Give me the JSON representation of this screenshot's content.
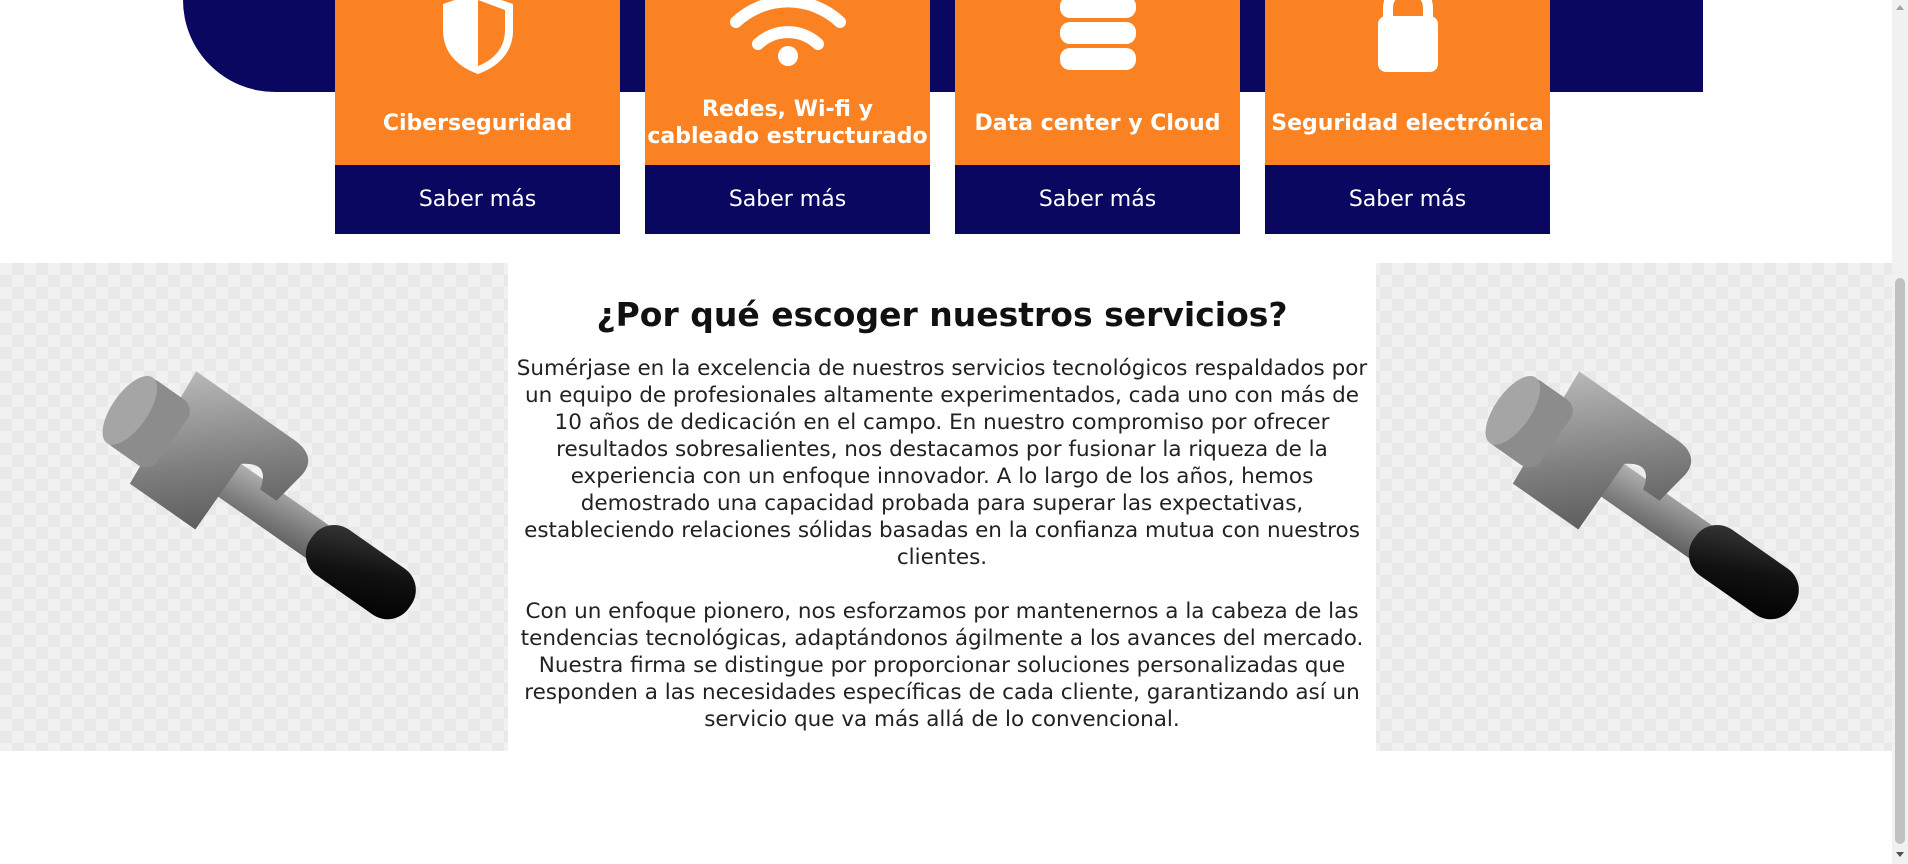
{
  "colors": {
    "brand_orange": "#fa8223",
    "brand_navy": "#0a0760",
    "text_dark": "#111111"
  },
  "services": [
    {
      "title": "Ciberseguridad",
      "icon": "shield-icon",
      "button": "Saber más"
    },
    {
      "title": "Redes, Wi-fi y cableado estructurado",
      "icon": "wifi-icon",
      "button": "Saber más"
    },
    {
      "title": "Data center y Cloud",
      "icon": "database-icon",
      "button": "Saber más"
    },
    {
      "title": "Seguridad electrónica",
      "icon": "lock-icon",
      "button": "Saber más"
    }
  ],
  "why": {
    "title": "¿Por qué escoger nuestros servicios?",
    "paragraph1_lines": [
      "Sumérjase en la excelencia de nuestros servicios tecnológicos respaldados por",
      "un equipo de profesionales altamente experimentados, cada uno con más de",
      "10 años de dedicación en el campo. En nuestro compromiso por ofrecer",
      "resultados sobresalientes, nos destacamos por fusionar la riqueza de la",
      "experiencia con un enfoque innovador. A lo largo de los años, hemos",
      "demostrado una capacidad probada para superar las expectativas,",
      "estableciendo relaciones sólidas basadas en la confianza mutua con nuestros",
      "clientes."
    ],
    "paragraph2_lines": [
      "Con un enfoque pionero, nos esforzamos por mantenernos a la cabeza de las",
      "tendencias tecnológicas, adaptándonos ágilmente a los avances del mercado.",
      "Nuestra firma se distingue por proporcionar soluciones personalizadas que",
      "responden a las necesidades específicas de cada cliente, garantizando así un",
      "servicio que va más allá de lo convencional."
    ],
    "left_image": "hammer-icon",
    "right_image": "hammer-icon"
  }
}
